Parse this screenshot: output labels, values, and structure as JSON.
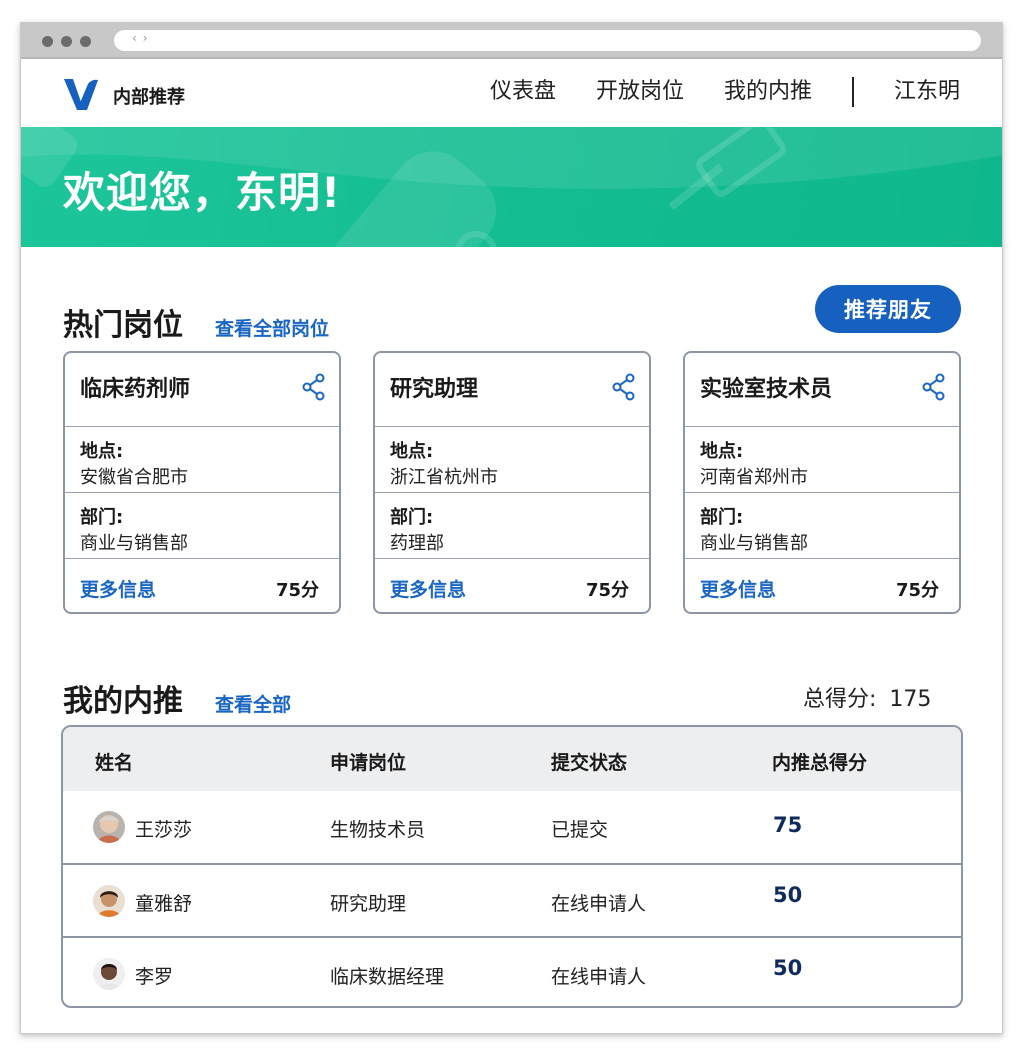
{
  "nav": {
    "brand": "内部推荐",
    "links": [
      "仪表盘",
      "开放岗位",
      "我的内推"
    ],
    "user": "江东明"
  },
  "hero": {
    "title": "欢迎您，东明!"
  },
  "hot_jobs": {
    "title": "热门岗位",
    "view_all": "查看全部岗位",
    "refer_button": "推荐朋友",
    "location_label": "地点:",
    "department_label": "部门:",
    "more_info": "更多信息",
    "cards": [
      {
        "title": "临床药剂师",
        "location": "安徽省合肥市",
        "department": "商业与销售部",
        "score": "75分"
      },
      {
        "title": "研究助理",
        "location": "浙江省杭州市",
        "department": "药理部",
        "score": "75分"
      },
      {
        "title": "实验室技术员",
        "location": "河南省郑州市",
        "department": "商业与销售部",
        "score": "75分"
      }
    ]
  },
  "my_referrals": {
    "title": "我的内推",
    "view_all": "查看全部",
    "total_label": "总得分:",
    "total_value": "175",
    "headers": [
      "姓名",
      "申请岗位",
      "提交状态",
      "内推总得分"
    ],
    "rows": [
      {
        "name": "王莎莎",
        "position": "生物技术员",
        "status": "已提交",
        "score": "75"
      },
      {
        "name": "童雅舒",
        "position": "研究助理",
        "status": "在线申请人",
        "score": "50"
      },
      {
        "name": "李罗",
        "position": "临床数据经理",
        "status": "在线申请人",
        "score": "50"
      }
    ]
  },
  "colors": {
    "primary": "#1660bf",
    "link": "#1a66c2",
    "hero": "#13bb91",
    "score": "#0f2b5b"
  }
}
